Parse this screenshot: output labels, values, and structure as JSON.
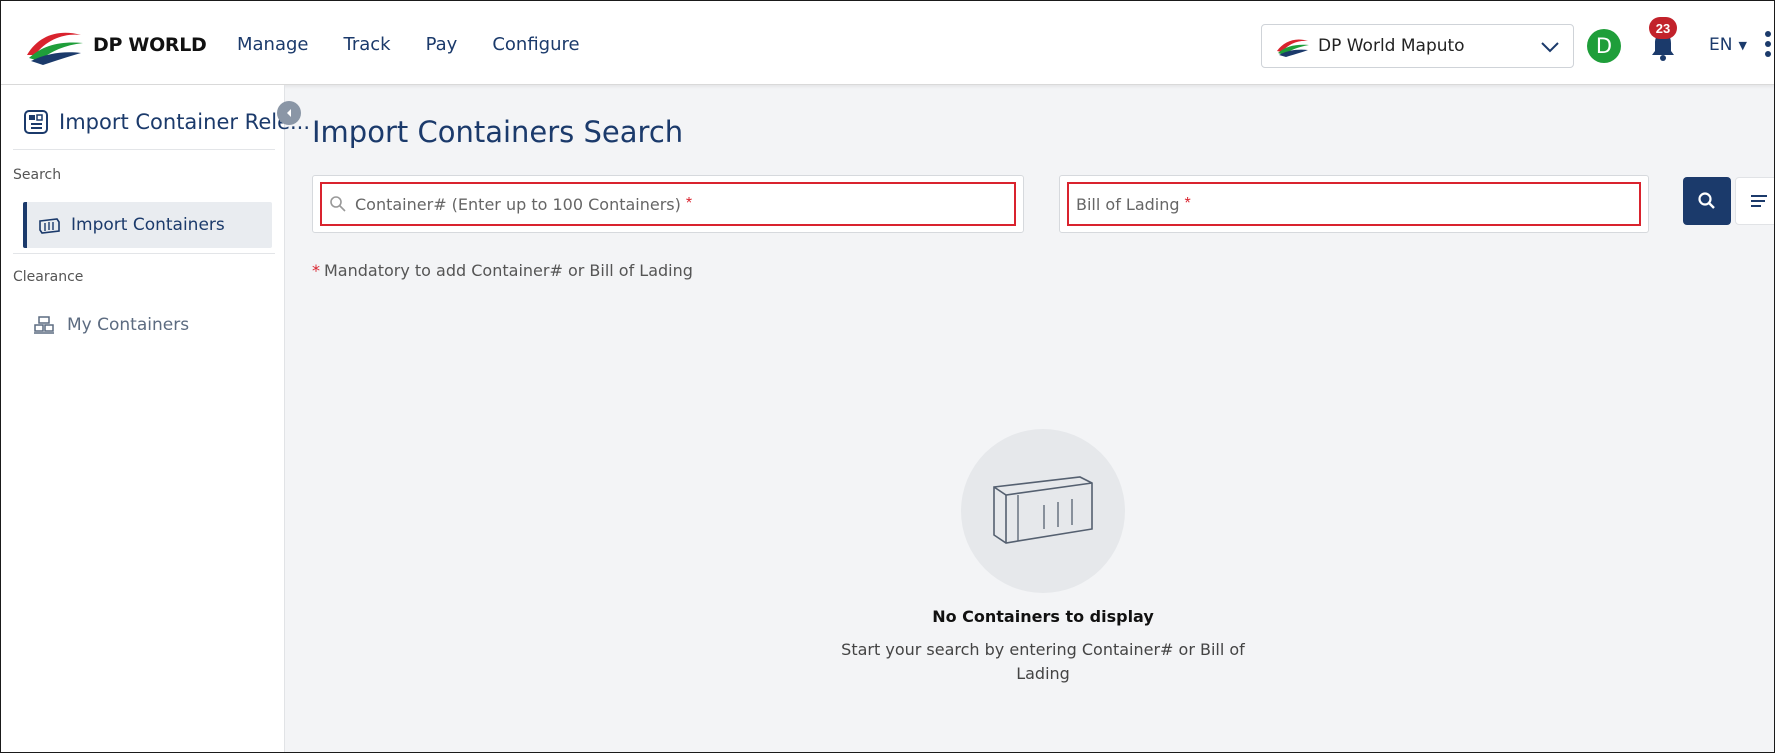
{
  "header": {
    "brand": "DP WORLD",
    "nav": [
      "Manage",
      "Track",
      "Pay",
      "Configure"
    ],
    "terminal": "DP World Maputo",
    "avatar_initial": "D",
    "notification_count": "23",
    "language": "EN"
  },
  "sidebar": {
    "module_title": "Import Container Rele...",
    "sections": [
      {
        "label": "Search",
        "items": [
          {
            "label": "Import Containers",
            "active": true
          }
        ]
      },
      {
        "label": "Clearance",
        "items": [
          {
            "label": "My Containers",
            "active": false
          }
        ]
      }
    ]
  },
  "main": {
    "title": "Import Containers Search",
    "container_field": {
      "placeholder": "Container# (Enter up to 100 Containers)",
      "required_mark": "*"
    },
    "bol_field": {
      "placeholder": "Bill of Lading",
      "required_mark": "*"
    },
    "mandatory_star": "*",
    "mandatory_note": "Mandatory to add Container# or Bill of Lading",
    "empty_state": {
      "title": "No Containers to display",
      "description": "Start your search by entering Container# or Bill of Lading"
    }
  },
  "colors": {
    "primary": "#1b3a6b",
    "error": "#d9232e",
    "avatar": "#1f9e3a",
    "badge": "#c2222b"
  },
  "icons": {
    "search": "search-icon",
    "filter": "filter-icon",
    "bell": "bell-icon",
    "chevron": "chevron-down-icon",
    "container": "container-icon"
  }
}
